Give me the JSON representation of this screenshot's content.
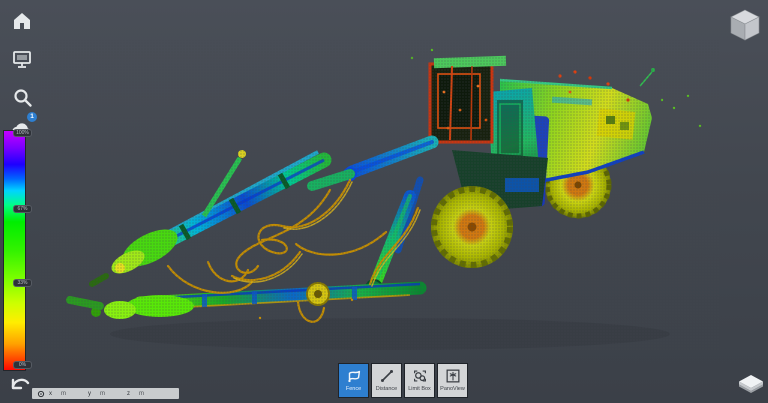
{
  "app": {
    "background_top": "#4a4f58",
    "background_bottom": "#3b4048",
    "accent_blue": "#2e7fd0"
  },
  "sidebar": {
    "buttons": [
      {
        "id": "home",
        "icon": "home-icon"
      },
      {
        "id": "display",
        "icon": "display-icon"
      },
      {
        "id": "search",
        "icon": "search-icon"
      },
      {
        "id": "point-cloud",
        "icon": "cloud-icon",
        "badge": "1"
      }
    ]
  },
  "legend": {
    "colors_top_to_bottom": [
      "#c400ff",
      "#7a00ff",
      "#1e00ff",
      "#0066ff",
      "#00d4ff",
      "#00ff88",
      "#00ee00",
      "#33f200",
      "#7dff00",
      "#ccff00",
      "#ffee00",
      "#ffa200",
      "#ff4000",
      "#ff0800"
    ],
    "handles": [
      {
        "label": "100%"
      },
      {
        "label": "67%"
      },
      {
        "label": "33%"
      },
      {
        "label": "0%"
      }
    ]
  },
  "status_bar": {
    "marker_icon": "crosshair-icon",
    "back_icon": "back-arrow-icon",
    "fields": [
      {
        "axis": "x",
        "unit": "m"
      },
      {
        "axis": "y",
        "unit": "m"
      },
      {
        "axis": "z",
        "unit": "m"
      }
    ]
  },
  "toolbar": {
    "buttons": [
      {
        "label": "Fence",
        "icon": "fence-icon",
        "active": true
      },
      {
        "label": "Distance",
        "icon": "distance-icon",
        "active": false
      },
      {
        "label": "Limit Box",
        "icon": "limit-box-icon",
        "active": false
      },
      {
        "label": "PanoView",
        "icon": "panoview-icon",
        "active": false
      }
    ]
  },
  "corner": {
    "icon": "layers-icon"
  },
  "viewport": {
    "nav_cube_icon": "navigation-cube-icon"
  }
}
